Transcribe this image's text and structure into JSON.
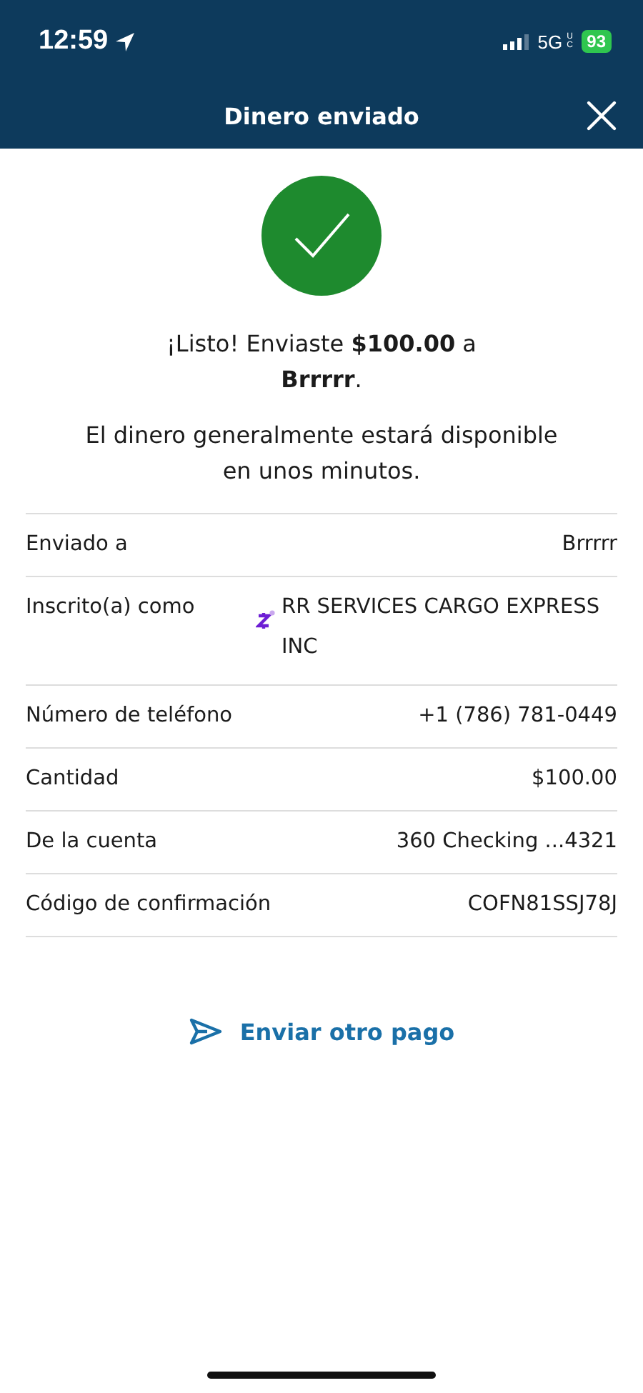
{
  "status_bar": {
    "time": "12:59",
    "network": "5G",
    "network_badge": "UC",
    "battery": "93"
  },
  "header": {
    "title": "Dinero enviado"
  },
  "message": "¡Listo! Enviaste **$100.00** a **Brrrrr**.",
  "note": "El dinero generalmente estará disponible en unos minutos.",
  "details": [
    {
      "kind": "plain",
      "label": "Enviado a",
      "value": "Brrrrr"
    },
    {
      "kind": "zelle",
      "label": "Inscrito(a) como",
      "value": "RR SERVICES CARGO EXPRESS INC"
    },
    {
      "kind": "plain",
      "label": "Número de teléfono",
      "value": "+1 (786) 781-0449"
    },
    {
      "kind": "plain",
      "label": "Cantidad",
      "value": "$100.00"
    },
    {
      "kind": "plain",
      "label": "De la cuenta",
      "value": "360 Checking ...4321"
    },
    {
      "kind": "plain",
      "label": "Código de confirmación",
      "value": "COFN81SSJ78J"
    }
  ],
  "action": {
    "label": "Enviar otro pago"
  }
}
